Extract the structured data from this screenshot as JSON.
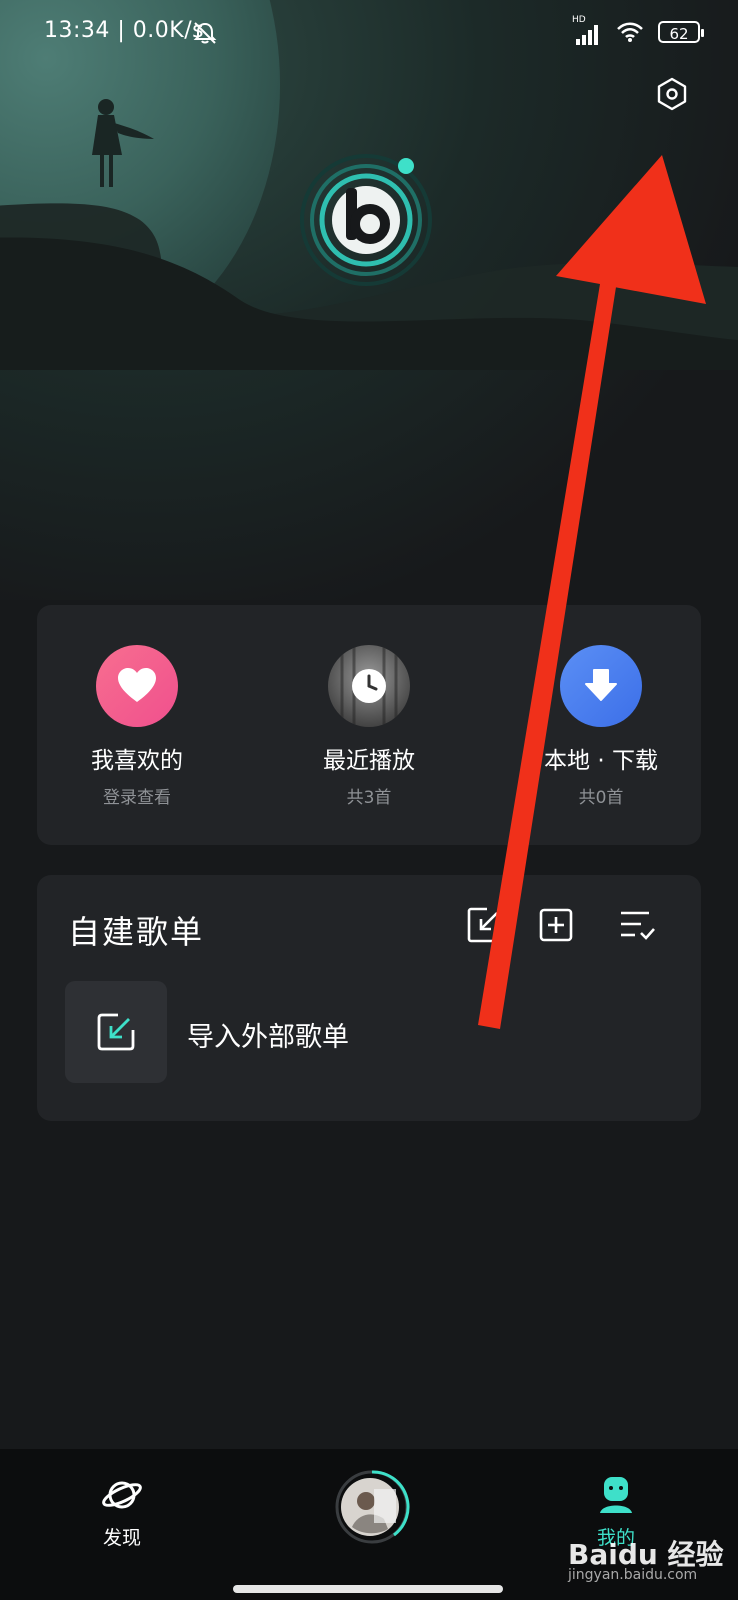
{
  "status_bar": {
    "time": "13:34 | 0.0K/s",
    "network_label": "HD",
    "battery": "62"
  },
  "quick_access": [
    {
      "title": "我喜欢的",
      "subtitle": "登录查看",
      "icon": "heart-icon",
      "color": "#f4628a"
    },
    {
      "title": "最近播放",
      "subtitle": "共3首",
      "icon": "clock-icon",
      "color": "#6d6d6d"
    },
    {
      "title": "本地 · 下载",
      "subtitle": "共0首",
      "icon": "download-icon",
      "color": "#4a82f2"
    }
  ],
  "playlist_section": {
    "title": "自建歌单",
    "actions": [
      "import-icon",
      "add-icon",
      "sort-icon"
    ],
    "import_label": "导入外部歌单"
  },
  "tabbar": {
    "discover_label": "发现",
    "mine_label": "我的"
  },
  "watermark": {
    "text": "Baidu 经验",
    "sub": "jingyan.baidu.com"
  },
  "colors": {
    "accent": "#3ee0c9",
    "annotation_arrow": "#f0301a",
    "card_bg": "#222427"
  }
}
